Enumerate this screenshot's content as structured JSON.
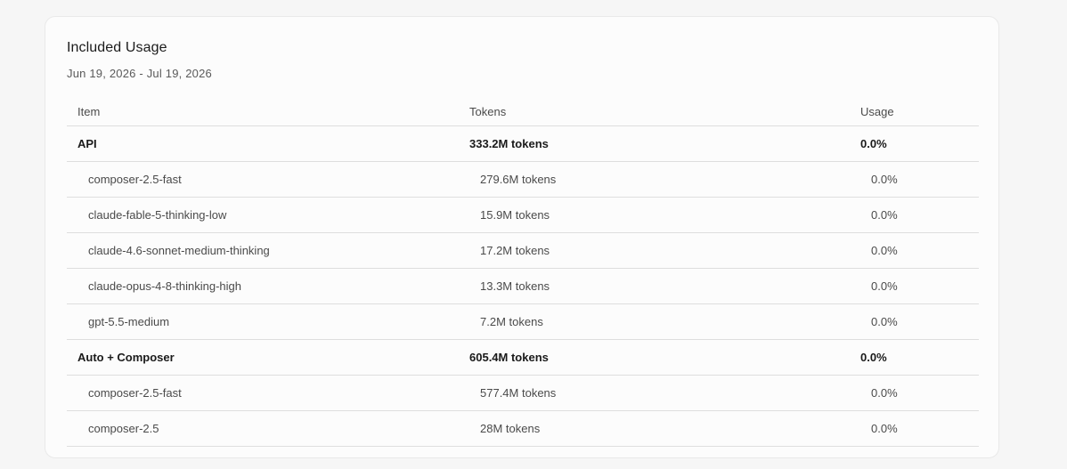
{
  "card": {
    "title": "Included Usage",
    "date_range": "Jun 19, 2026 - Jul 19, 2026"
  },
  "table": {
    "headers": {
      "item": "Item",
      "tokens": "Tokens",
      "usage": "Usage"
    },
    "groups": [
      {
        "name": "API",
        "tokens": "333.2M tokens",
        "usage": "0.0%",
        "rows": [
          {
            "name": "composer-2.5-fast",
            "tokens": "279.6M tokens",
            "usage": "0.0%"
          },
          {
            "name": "claude-fable-5-thinking-low",
            "tokens": "15.9M tokens",
            "usage": "0.0%"
          },
          {
            "name": "claude-4.6-sonnet-medium-thinking",
            "tokens": "17.2M tokens",
            "usage": "0.0%"
          },
          {
            "name": "claude-opus-4-8-thinking-high",
            "tokens": "13.3M tokens",
            "usage": "0.0%"
          },
          {
            "name": "gpt-5.5-medium",
            "tokens": "7.2M tokens",
            "usage": "0.0%"
          }
        ]
      },
      {
        "name": "Auto + Composer",
        "tokens": "605.4M tokens",
        "usage": "0.0%",
        "rows": [
          {
            "name": "composer-2.5-fast",
            "tokens": "577.4M tokens",
            "usage": "0.0%"
          },
          {
            "name": "composer-2.5",
            "tokens": "28M tokens",
            "usage": "0.0%"
          }
        ]
      }
    ]
  }
}
